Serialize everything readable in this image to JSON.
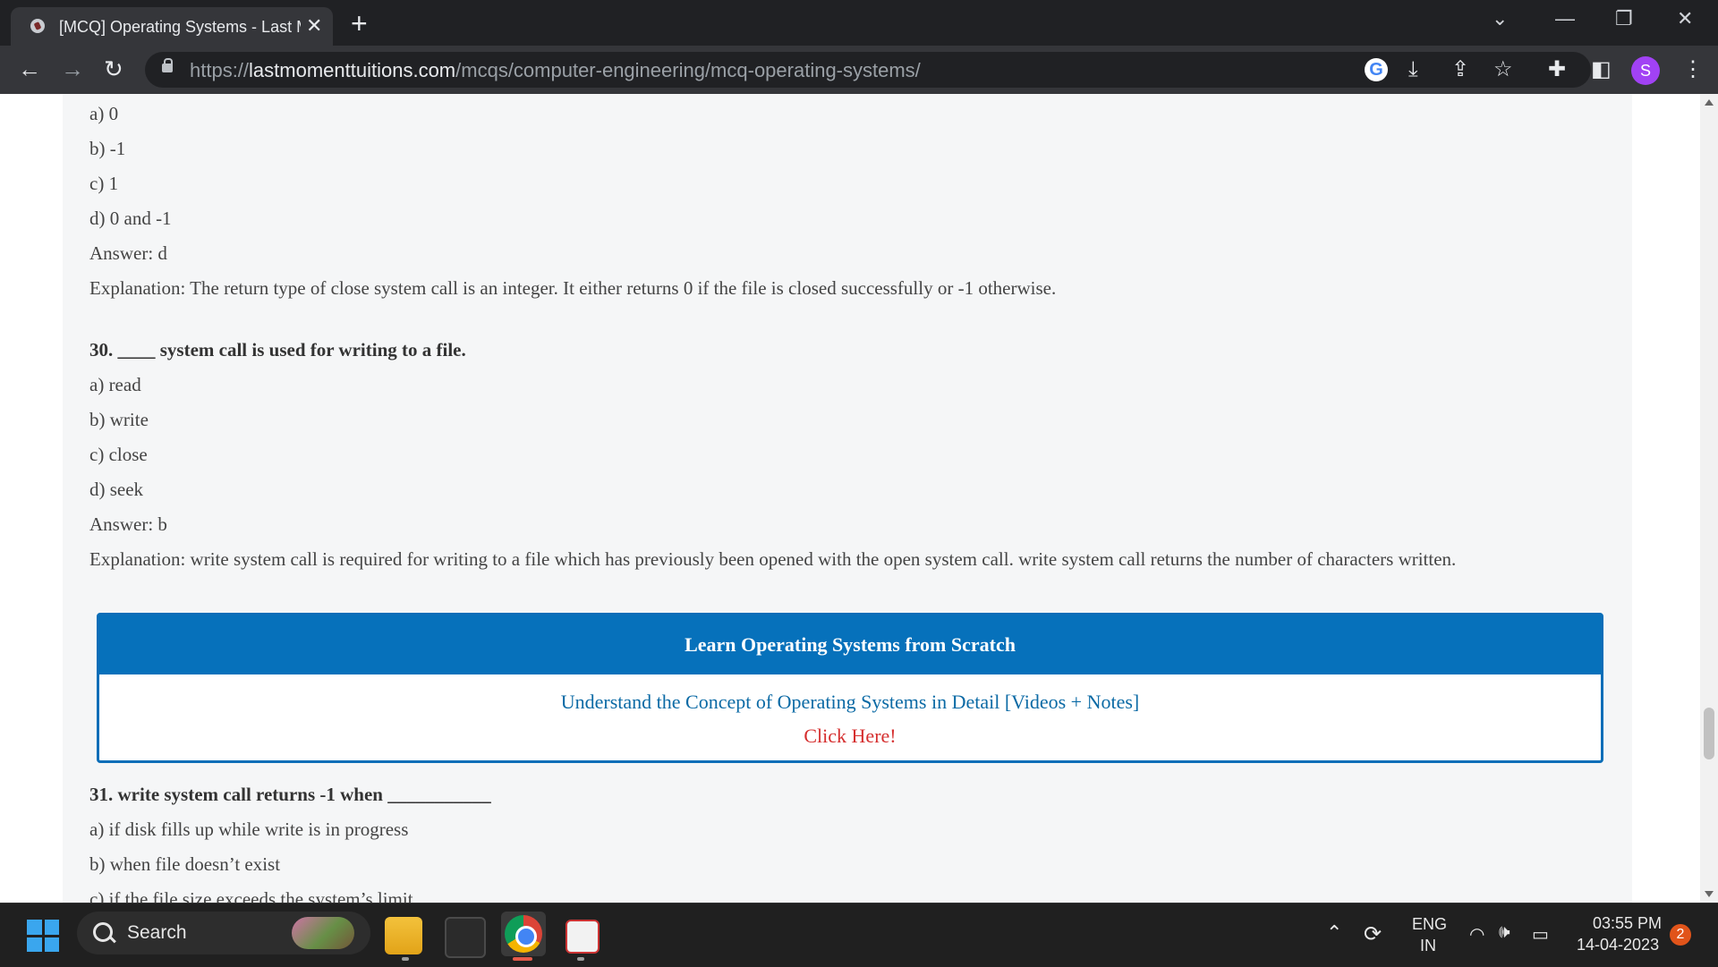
{
  "browser": {
    "tab_title": "[MCQ] Operating Systems - Last Moment Tuitions",
    "tab_close": "✕",
    "new_tab": "+",
    "url_scheme": "https://",
    "url_host": "lastmomenttuitions.com",
    "url_path": "/mcqs/computer-engineering/mcq-operating-systems/",
    "profile_initial": "S",
    "google_letter": "G"
  },
  "page": {
    "q29": {
      "option_a": "a) 0",
      "option_b": "b) -1",
      "option_c": "c) 1",
      "option_d": "d) 0 and -1",
      "answer": "Answer: d",
      "explanation": "Explanation: The return type of close system call is an integer. It either returns 0 if the file is closed successfully or -1 otherwise."
    },
    "q30": {
      "question": "30. ____ system call is used for writing to a file.",
      "option_a": "a) read",
      "option_b": "b) write",
      "option_c": "c) close",
      "option_d": "d) seek",
      "answer": "Answer: b",
      "explanation": "Explanation: write system call is required for writing to a file which has previously been opened with the open system call. write system call returns the number of characters written."
    },
    "promo": {
      "heading": "Learn Operating Systems from Scratch",
      "link": "Understand the Concept of Operating Systems in Detail [Videos + Notes]",
      "cta": "Click Here!"
    },
    "q31": {
      "question": "31. write system call returns -1 when ___________",
      "option_a": "a) if disk fills up while write is in progress",
      "option_b": "b) when file doesn’t exist",
      "option_c": "c) if the file size exceeds the system’s limit"
    }
  },
  "taskbar": {
    "search_label": "Search",
    "lang_1": "ENG",
    "lang_2": "IN",
    "time": "03:55 PM",
    "date": "14-04-2023",
    "notification_count": "2"
  }
}
